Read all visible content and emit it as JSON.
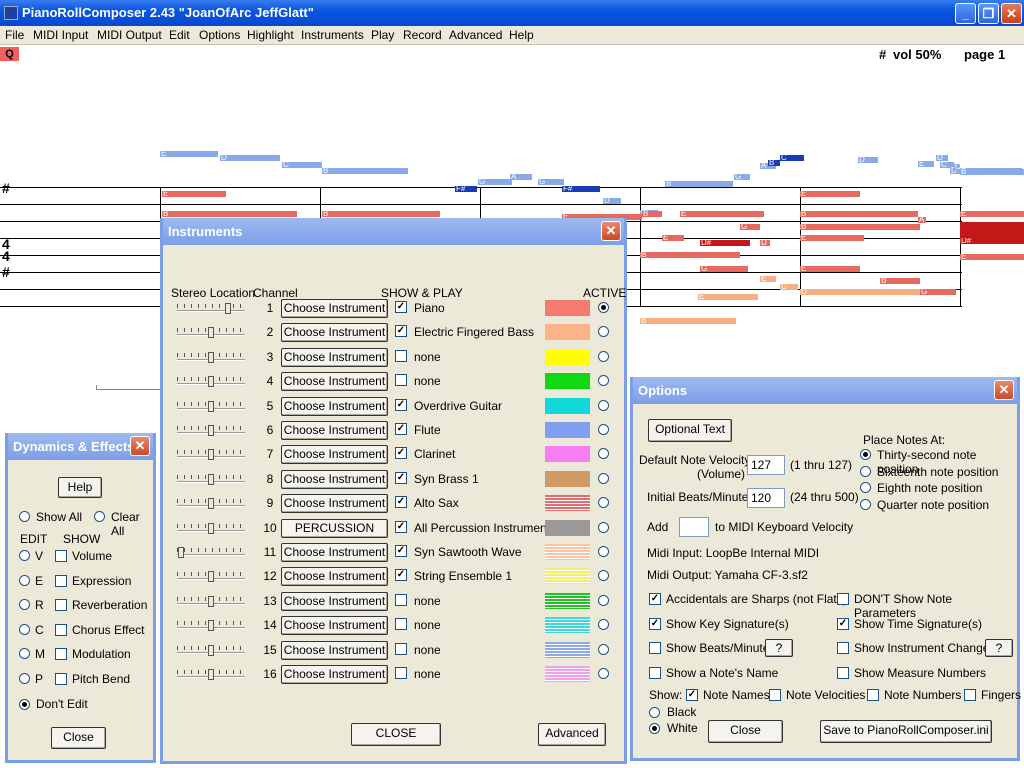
{
  "window": {
    "title": "PianoRollComposer 2.43  \"JoanOfArc JeffGlatt\"",
    "minimize": "_",
    "maximize": "❐",
    "close": "✕"
  },
  "menu": [
    "File",
    "MIDI Input",
    "MIDI Output",
    "Edit",
    "Options",
    "Highlight",
    "Instruments",
    "Play",
    "Record",
    "Advanced",
    "Help"
  ],
  "toolbar": {
    "q_badge": "Q",
    "status_sharp": "#",
    "status_vol": "vol  50%",
    "status_page": "page 1"
  },
  "score": {
    "clef_sharp": "#",
    "time_sig_top": "4",
    "time_sig_bottom": "4",
    "notes": [
      {
        "l": "E",
        "c": "#88aae8"
      },
      {
        "l": "D",
        "c": "#88aae8"
      },
      {
        "l": "C",
        "c": "#88aae8"
      },
      {
        "l": "B",
        "c": "#88aae8"
      },
      {
        "l": "F#",
        "c": "#1a3bb5"
      },
      {
        "l": "G",
        "c": "#88aae8"
      },
      {
        "l": "A",
        "c": "#88aae8"
      },
      {
        "l": "G",
        "c": "#88aae8"
      },
      {
        "l": "F#",
        "c": "#1a3bb5"
      },
      {
        "l": "D",
        "c": "#88aae8"
      },
      {
        "l": "E",
        "c": "#88aae8"
      },
      {
        "l": "B",
        "c": "#88aae8"
      },
      {
        "l": "G",
        "c": "#88aae8"
      },
      {
        "l": "A",
        "c": "#88aae8"
      },
      {
        "l": "B",
        "c": "#1a3bb5"
      },
      {
        "l": "C",
        "c": "#1a3bb5"
      },
      {
        "l": "D",
        "c": "#88aae8"
      },
      {
        "l": "E",
        "c": "#88aae8"
      },
      {
        "l": "D",
        "c": "#88aae8"
      },
      {
        "l": "C",
        "c": "#88aae8"
      },
      {
        "l": "D",
        "c": "#88aae8"
      },
      {
        "l": "C",
        "c": "#88aae8"
      },
      {
        "l": "B",
        "c": "#88aae8"
      },
      {
        "l": "E",
        "c": "#e46a60"
      },
      {
        "l": "B",
        "c": "#e46a60"
      },
      {
        "l": "B",
        "c": "#e46a60"
      },
      {
        "l": "E",
        "c": "#e46a60"
      },
      {
        "l": "B",
        "c": "#e46a60"
      },
      {
        "l": "E",
        "c": "#e46a60"
      },
      {
        "l": "E",
        "c": "#e46a60"
      },
      {
        "l": "B",
        "c": "#e46a60"
      },
      {
        "l": "B",
        "c": "#e46a60"
      },
      {
        "l": "E",
        "c": "#e46a60"
      },
      {
        "l": "G",
        "c": "#e46a60"
      },
      {
        "l": "A",
        "c": "#e46a60"
      },
      {
        "l": "E",
        "c": "#e46a60"
      },
      {
        "l": "D#",
        "c": "#c41818"
      },
      {
        "l": "D",
        "c": "#e46a60"
      },
      {
        "l": "E",
        "c": "#e46a60"
      },
      {
        "l": "D#",
        "c": "#c41818"
      },
      {
        "l": "B",
        "c": "#e46a60"
      },
      {
        "l": "G",
        "c": "#e46a60"
      },
      {
        "l": "E",
        "c": "#f4b080"
      },
      {
        "l": "C",
        "c": "#f4b080"
      },
      {
        "l": "E",
        "c": "#e46a60"
      },
      {
        "l": "D",
        "c": "#f4b080"
      },
      {
        "l": "B",
        "c": "#e46a60"
      },
      {
        "l": "E",
        "c": "#e46a60"
      },
      {
        "l": "E",
        "c": "#e46a60"
      },
      {
        "l": "E",
        "c": "#f4b080"
      },
      {
        "l": "G",
        "c": "#e46a60"
      },
      {
        "l": "B",
        "c": "#f4b080"
      }
    ]
  },
  "instruments": {
    "title": "Instruments",
    "headers": {
      "stereo": "Stereo Location",
      "channel": "Channel",
      "show_play": "SHOW & PLAY",
      "active": "ACTIVE"
    },
    "rows": [
      {
        "ch": "1",
        "button": "Choose Instrument",
        "checked": true,
        "name": "Piano",
        "color": "#f47b6e",
        "style": "solid",
        "active": true,
        "pan": 0.78
      },
      {
        "ch": "2",
        "button": "Choose Instrument",
        "checked": true,
        "name": "Electric Fingered Bass",
        "color": "#fbb48a",
        "style": "solid",
        "active": false,
        "pan": 0.5
      },
      {
        "ch": "3",
        "button": "Choose Instrument",
        "checked": false,
        "name": "none",
        "color": "#ffff00",
        "style": "solid",
        "active": false,
        "pan": 0.5
      },
      {
        "ch": "4",
        "button": "Choose Instrument",
        "checked": false,
        "name": "none",
        "color": "#11d811",
        "style": "solid",
        "active": false,
        "pan": 0.5
      },
      {
        "ch": "5",
        "button": "Choose Instrument",
        "checked": true,
        "name": "Overdrive Guitar",
        "color": "#11d8d8",
        "style": "solid",
        "active": false,
        "pan": 0.5
      },
      {
        "ch": "6",
        "button": "Choose Instrument",
        "checked": true,
        "name": "Flute",
        "color": "#7f9fef",
        "style": "solid",
        "active": false,
        "pan": 0.5
      },
      {
        "ch": "7",
        "button": "Choose Instrument",
        "checked": true,
        "name": "Clarinet",
        "color": "#f87ef5",
        "style": "solid",
        "active": false,
        "pan": 0.5
      },
      {
        "ch": "8",
        "button": "Choose Instrument",
        "checked": true,
        "name": "Syn Brass 1",
        "color": "#d09a64",
        "style": "solid",
        "active": false,
        "pan": 0.5
      },
      {
        "ch": "9",
        "button": "Choose Instrument",
        "checked": true,
        "name": "Alto Sax",
        "color": "#e07070",
        "style": "striped",
        "active": false,
        "pan": 0.5
      },
      {
        "ch": "10",
        "button": "PERCUSSION",
        "checked": true,
        "name": "All Percussion Instruments",
        "color": "#999999",
        "style": "solid",
        "active": false,
        "pan": 0.5
      },
      {
        "ch": "11",
        "button": "Choose Instrument",
        "checked": true,
        "name": "Syn Sawtooth Wave",
        "color": "#f8c4a4",
        "style": "striped",
        "active": false,
        "pan": 0.02
      },
      {
        "ch": "12",
        "button": "Choose Instrument",
        "checked": true,
        "name": "String Ensemble 1",
        "color": "#f2ee70",
        "style": "striped",
        "active": false,
        "pan": 0.5
      },
      {
        "ch": "13",
        "button": "Choose Instrument",
        "checked": false,
        "name": "none",
        "color": "#28c028",
        "style": "striped",
        "active": false,
        "pan": 0.5
      },
      {
        "ch": "14",
        "button": "Choose Instrument",
        "checked": false,
        "name": "none",
        "color": "#40d8d8",
        "style": "striped",
        "active": false,
        "pan": 0.5
      },
      {
        "ch": "15",
        "button": "Choose Instrument",
        "checked": false,
        "name": "none",
        "color": "#8ca8e8",
        "style": "striped",
        "active": false,
        "pan": 0.5
      },
      {
        "ch": "16",
        "button": "Choose Instrument",
        "checked": false,
        "name": "none",
        "color": "#f0a0ee",
        "style": "striped",
        "active": false,
        "pan": 0.5
      }
    ],
    "close_label": "CLOSE",
    "advanced_label": "Advanced"
  },
  "dynamics": {
    "title": "Dynamics & Effects",
    "help": "Help",
    "show_all": "Show All",
    "clear_all": "Clear All",
    "edit_header": "EDIT",
    "show_header": "SHOW",
    "items": [
      {
        "k": "V",
        "l": "Volume"
      },
      {
        "k": "E",
        "l": "Expression"
      },
      {
        "k": "R",
        "l": "Reverberation"
      },
      {
        "k": "C",
        "l": "Chorus Effect"
      },
      {
        "k": "M",
        "l": "Modulation"
      },
      {
        "k": "P",
        "l": "Pitch Bend"
      }
    ],
    "dont_edit": "Don't Edit",
    "close": "Close"
  },
  "options": {
    "title": "Options",
    "optional_text": "Optional Text",
    "velocity_label": "Default Note Velocity",
    "velocity_label2": "(Volume)",
    "velocity_value": "127",
    "velocity_range": "(1 thru 127)",
    "bpm_label": "Initial Beats/Minute",
    "bpm_value": "120",
    "bpm_range": "(24 thru 500)",
    "add_label": "Add",
    "add_value": "",
    "add_suffix": "to MIDI Keyboard Velocity",
    "place_header": "Place Notes At:",
    "place": [
      {
        "l": "Thirty-second note position",
        "on": true
      },
      {
        "l": "Sixteenth note position",
        "on": false
      },
      {
        "l": "Eighth note position",
        "on": false
      },
      {
        "l": "Quarter note position",
        "on": false
      }
    ],
    "midi_input": "Midi Input:  LoopBe Internal MIDI",
    "midi_output": "Midi Output:  Yamaha CF-3.sf2",
    "checks_left": [
      {
        "l": "Accidentals are Sharps (not Flats)",
        "on": true
      },
      {
        "l": "Show Key Signature(s)",
        "on": true
      },
      {
        "l": "Show Beats/Minute",
        "on": false
      },
      {
        "l": "Show a Note's Name",
        "on": false
      }
    ],
    "checks_right": [
      {
        "l": "DON'T Show Note Parameters",
        "on": false
      },
      {
        "l": "Show Time Signature(s)",
        "on": true
      },
      {
        "l": "Show Instrument Changes",
        "on": false
      },
      {
        "l": "Show Measure Numbers",
        "on": false
      }
    ],
    "q_btn": "?",
    "show_label": "Show:",
    "show": [
      {
        "l": "Note Names",
        "on": true
      },
      {
        "l": "Note Velocities",
        "on": false
      },
      {
        "l": "Note Numbers",
        "on": false
      },
      {
        "l": "Fingers",
        "on": false
      }
    ],
    "bg": [
      {
        "l": "Black",
        "on": false
      },
      {
        "l": "White",
        "on": true
      }
    ],
    "close": "Close",
    "save": "Save to PianoRollComposer.ini"
  }
}
